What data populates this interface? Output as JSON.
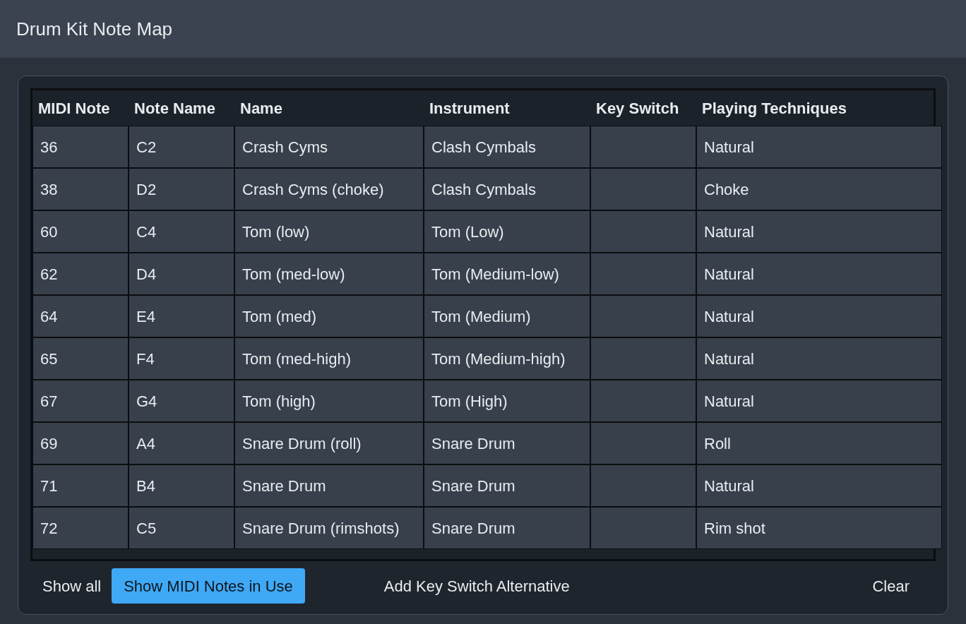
{
  "window": {
    "title": "Drum Kit Note Map"
  },
  "table": {
    "columns": [
      "MIDI Note",
      "Note Name",
      "Name",
      "Instrument",
      "Key Switch",
      "Playing Techniques"
    ],
    "rows": [
      [
        "36",
        "C2",
        "Crash Cyms",
        "Clash Cymbals",
        "",
        "Natural"
      ],
      [
        "38",
        "D2",
        "Crash Cyms (choke)",
        "Clash Cymbals",
        "",
        "Choke"
      ],
      [
        "60",
        "C4",
        "Tom (low)",
        "Tom (Low)",
        "",
        "Natural"
      ],
      [
        "62",
        "D4",
        "Tom (med-low)",
        "Tom (Medium-low)",
        "",
        "Natural"
      ],
      [
        "64",
        "E4",
        "Tom (med)",
        "Tom (Medium)",
        "",
        "Natural"
      ],
      [
        "65",
        "F4",
        "Tom (med-high)",
        "Tom (Medium-high)",
        "",
        "Natural"
      ],
      [
        "67",
        "G4",
        "Tom (high)",
        "Tom (High)",
        "",
        "Natural"
      ],
      [
        "69",
        "A4",
        "Snare Drum (roll)",
        "Snare Drum",
        "",
        "Roll"
      ],
      [
        "71",
        "B4",
        "Snare Drum",
        "Snare Drum",
        "",
        "Natural"
      ],
      [
        "72",
        "C5",
        "Snare Drum (rimshots)",
        "Snare Drum",
        "",
        "Rim shot"
      ]
    ]
  },
  "filters": [
    {
      "label": "Show all",
      "selected": false
    },
    {
      "label": "Show MIDI Notes in Use",
      "selected": true
    }
  ],
  "actions": [
    "Add Key Switch Alternative",
    "Clear"
  ]
}
